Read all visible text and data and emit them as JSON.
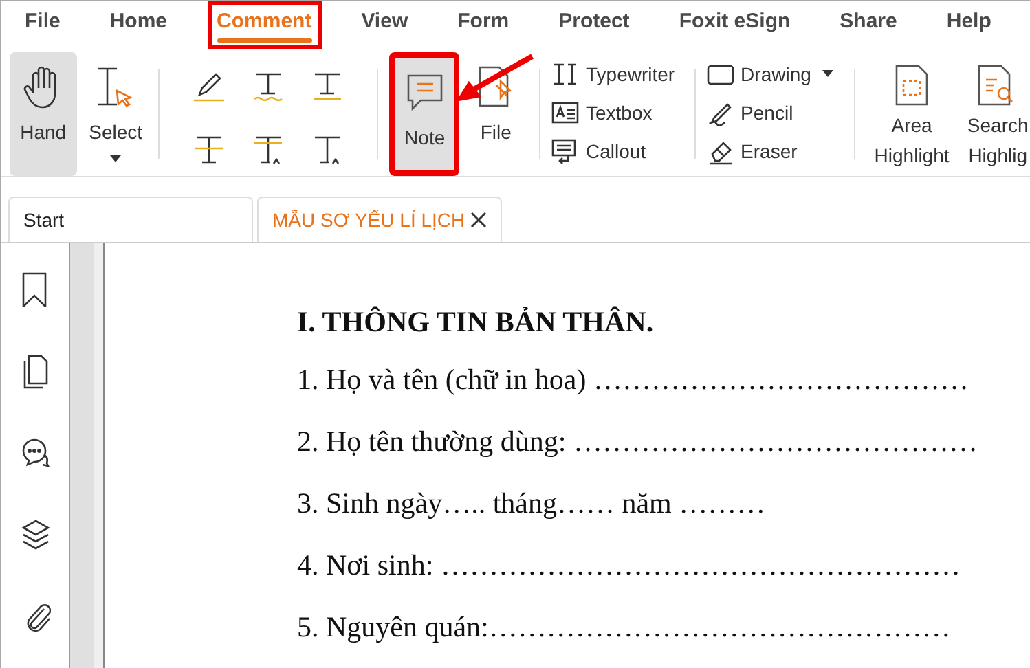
{
  "menu_tabs": [
    {
      "label": "File",
      "selected": false,
      "highlighted": false
    },
    {
      "label": "Home",
      "selected": false,
      "highlighted": false
    },
    {
      "label": "Comment",
      "selected": true,
      "highlighted": true
    },
    {
      "label": "View",
      "selected": false,
      "highlighted": false
    },
    {
      "label": "Form",
      "selected": false,
      "highlighted": false
    },
    {
      "label": "Protect",
      "selected": false,
      "highlighted": false
    },
    {
      "label": "Foxit eSign",
      "selected": false,
      "highlighted": false
    },
    {
      "label": "Share",
      "selected": false,
      "highlighted": false
    },
    {
      "label": "Help",
      "selected": false,
      "highlighted": false
    }
  ],
  "ribbon": {
    "pointer_tools": [
      {
        "label": "Hand",
        "selected": true,
        "dropdown": false
      },
      {
        "label": "Select",
        "selected": false,
        "dropdown": true
      }
    ],
    "note_tools": [
      {
        "label": "Note",
        "selected": true,
        "highlighted": true
      },
      {
        "label": "File",
        "selected": false,
        "highlighted": false
      }
    ],
    "text_tools": [
      {
        "label": "Typewriter"
      },
      {
        "label": "Textbox"
      },
      {
        "label": "Callout"
      }
    ],
    "drawing_tools": [
      {
        "label": "Drawing",
        "dropdown": true
      },
      {
        "label": "Pencil",
        "dropdown": false
      },
      {
        "label": "Eraser",
        "dropdown": false
      }
    ],
    "highlight_tools": [
      {
        "label": "Area Highlight"
      },
      {
        "label": "Search Highlig"
      }
    ]
  },
  "doc_tabs": [
    {
      "label": "Start",
      "selected": false,
      "closable": false
    },
    {
      "label": "MẪU SƠ YẾU LÍ LỊCH",
      "selected": true,
      "closable": true
    }
  ],
  "document": {
    "heading": "I. THÔNG TIN BẢN THÂN.",
    "lines": [
      "1. Họ và tên (chữ in hoa) …………………………………",
      "2. Họ tên thường dùng: ……………………………………",
      "3. Sinh ngày….. tháng…… năm ………",
      "4. Nơi sinh: ………………………………………………",
      "5. Nguyên quán:…………………………………………"
    ]
  }
}
